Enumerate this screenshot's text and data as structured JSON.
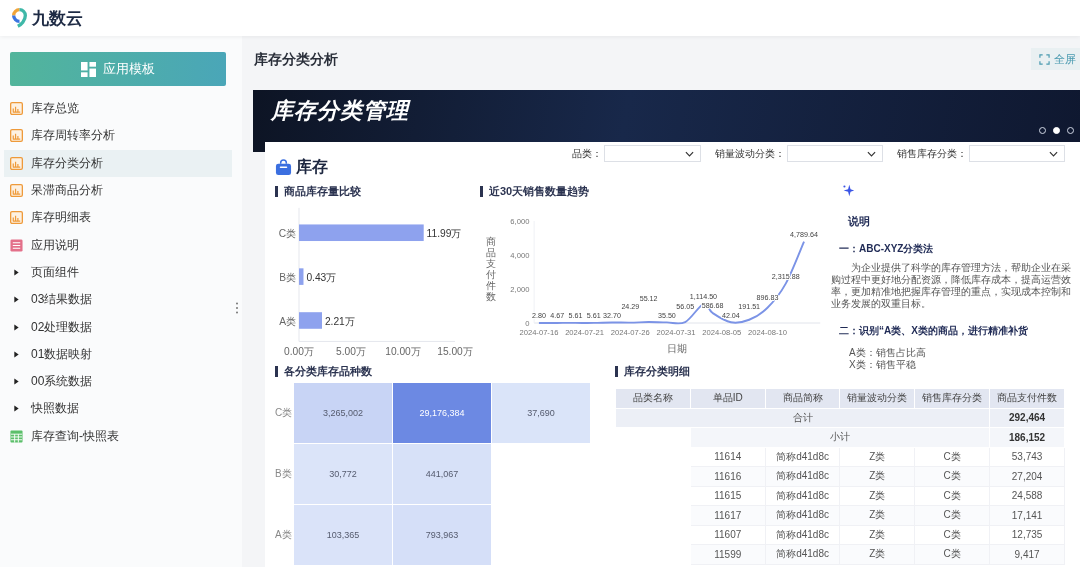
{
  "app": {
    "name": "九数云"
  },
  "sidebar": {
    "template_button": "应用模板",
    "items": [
      {
        "label": "库存总览",
        "kind": "dashboard",
        "selected": false
      },
      {
        "label": "库存周转率分析",
        "kind": "dashboard",
        "selected": false
      },
      {
        "label": "库存分类分析",
        "kind": "dashboard",
        "selected": true
      },
      {
        "label": "呆滞商品分析",
        "kind": "dashboard",
        "selected": false
      },
      {
        "label": "库存明细表",
        "kind": "dashboard",
        "selected": false
      },
      {
        "label": "应用说明",
        "kind": "doc",
        "selected": false
      },
      {
        "label": "页面组件",
        "kind": "folder",
        "selected": false,
        "expanded": false
      },
      {
        "label": "03结果数据",
        "kind": "folder",
        "selected": false,
        "expanded": false
      },
      {
        "label": "02处理数据",
        "kind": "folder",
        "selected": false,
        "expanded": false
      },
      {
        "label": "01数据映射",
        "kind": "folder",
        "selected": false,
        "expanded": false
      },
      {
        "label": "00系统数据",
        "kind": "folder",
        "selected": false,
        "expanded": false
      },
      {
        "label": "快照数据",
        "kind": "folder",
        "selected": false,
        "expanded": false
      },
      {
        "label": "库存查询-快照表",
        "kind": "table",
        "selected": false
      }
    ]
  },
  "page": {
    "title": "库存分类分析",
    "fullscreen": "全屏"
  },
  "banner": {
    "title": "库存分类管理",
    "dots": [
      {
        "selected": false
      },
      {
        "selected": true
      },
      {
        "selected": false
      }
    ]
  },
  "card": {
    "title": "库存",
    "filters": [
      {
        "label": "品类："
      },
      {
        "label": "销量波动分类："
      },
      {
        "label": "销售库存分类："
      }
    ]
  },
  "stock_chart": {
    "title": "商品库存量比较",
    "chart_data": {
      "type": "bar",
      "orientation": "horizontal",
      "categories": [
        "C类",
        "B类",
        "A类"
      ],
      "values": [
        11.99,
        0.43,
        2.21
      ],
      "value_labels": [
        "11.99万",
        "0.43万",
        "2.21万"
      ],
      "xlim": [
        0,
        15
      ],
      "xticks": [
        {
          "value": 0,
          "label": "0.00万"
        },
        {
          "value": 5,
          "label": "5.00万"
        },
        {
          "value": 10,
          "label": "10.00万"
        },
        {
          "value": 15,
          "label": "15.00万"
        }
      ]
    }
  },
  "trend_chart": {
    "title": "近30天销售数量趋势",
    "chart_data": {
      "type": "line",
      "xlabel": "日期",
      "ylabel": "商品支付件数",
      "categories": [
        "2024-07-16",
        null,
        null,
        null,
        null,
        "2024-07-21",
        null,
        null,
        null,
        null,
        "2024-07-26",
        null,
        null,
        null,
        null,
        "2024-07-31",
        null,
        null,
        null,
        null,
        "2024-08-05",
        null,
        null,
        null,
        null,
        "2024-08-10",
        null,
        null,
        null,
        null
      ],
      "series": [
        {
          "color": "#7b93e6",
          "values": [
            2.8,
            null,
            4.67,
            null,
            5.61,
            null,
            5.61,
            null,
            32.7,
            null,
            24.29,
            null,
            55.12,
            null,
            35.5,
            null,
            56.05,
            null,
            1114.5,
            586.68,
            null,
            42.04,
            null,
            191.51,
            null,
            896.83,
            null,
            2315.88,
            null,
            4789.64
          ]
        }
      ],
      "value_labels": [
        "2.80",
        null,
        "4.67",
        null,
        "5.61",
        null,
        "5.61",
        null,
        "32.70",
        null,
        "24.29",
        null,
        "55.12",
        null,
        "35.50",
        null,
        "56.05",
        null,
        "1,114.50",
        "586.68",
        null,
        "42.04",
        null,
        "191.51",
        null,
        "896.83",
        null,
        "2,315.88",
        null,
        "4,789.64"
      ],
      "ylim": [
        0,
        6000
      ],
      "yticks": [
        {
          "value": 0,
          "label": "0"
        },
        {
          "value": 2000,
          "label": "2,000"
        },
        {
          "value": 4000,
          "label": "4,000"
        },
        {
          "value": 6000,
          "label": "6,000"
        }
      ]
    }
  },
  "explanation": {
    "heading": "说明",
    "sections": [
      {
        "title": "一：ABC-XYZ分类法",
        "paragraph": "为企业提供了科学的库存管理方法，帮助企业在采购过程中更好地分配资源，降低库存成本，提高运营效率，更加精准地把握库存管理的重点，实现成本控制和业务发展的双重目标。"
      },
      {
        "title": "二：识别“A类、X类的商品，进行精准补货",
        "lines": [
          "A类：销售占比高",
          "X类：销售平稳"
        ]
      }
    ]
  },
  "heatmap": {
    "title": "各分类库存品种数",
    "rows": [
      {
        "label": "C类",
        "cells": [
          "3,265,002",
          "29,176,384",
          "37,690"
        ]
      },
      {
        "label": "B类",
        "cells": [
          "30,772",
          "441,067"
        ]
      },
      {
        "label": "A类",
        "cells": [
          "103,365",
          "793,963"
        ]
      }
    ]
  },
  "detail_table": {
    "title": "库存分类明细",
    "columns": [
      "品类名称",
      "单品ID",
      "商品简称",
      "销量波动分类",
      "销售库存分类",
      "商品支付件数"
    ],
    "total": {
      "label": "合计",
      "value": "292,464"
    },
    "subtotal": {
      "label": "小计",
      "value": "186,152"
    },
    "rows": [
      [
        "",
        "11614",
        "简称d41d8c",
        "Z类",
        "C类",
        "53,743"
      ],
      [
        "",
        "11616",
        "简称d41d8c",
        "Z类",
        "C类",
        "27,204"
      ],
      [
        "",
        "11615",
        "简称d41d8c",
        "Z类",
        "C类",
        "24,588"
      ],
      [
        "",
        "11617",
        "简称d41d8c",
        "Z类",
        "C类",
        "17,141"
      ],
      [
        "",
        "11607",
        "简称d41d8c",
        "Z类",
        "C类",
        "12,735"
      ],
      [
        "",
        "11599",
        "简称d41d8c",
        "Z类",
        "C类",
        "9,417"
      ]
    ]
  }
}
